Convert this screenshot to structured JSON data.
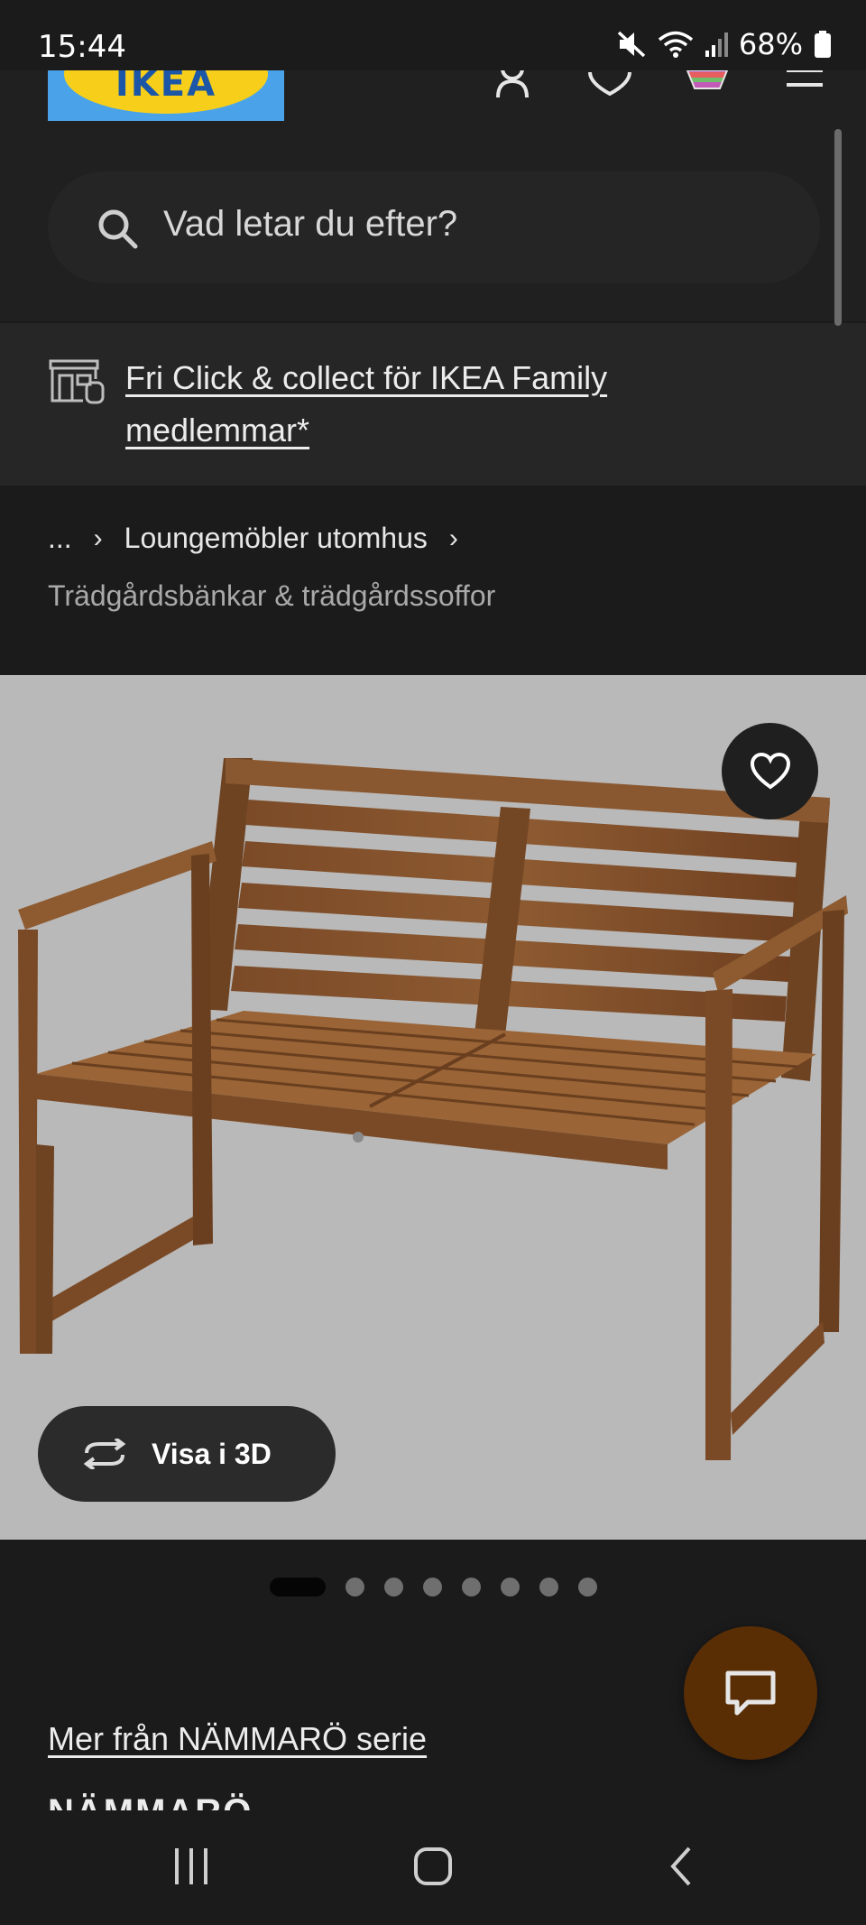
{
  "status_bar": {
    "time": "15:44",
    "battery": "68%",
    "icons": [
      "mute-icon",
      "wifi-icon",
      "signal-icon",
      "battery-icon"
    ]
  },
  "header": {
    "logo_text": "IKEA",
    "icons": [
      "account-icon",
      "heart-icon",
      "shopping-bag-icon",
      "menu-icon"
    ]
  },
  "search": {
    "placeholder": "Vad letar du efter?"
  },
  "banner": {
    "text": "Fri Click & collect för IKEA Family medlemmar*"
  },
  "breadcrumb": {
    "ellipsis": "...",
    "parent": "Loungemöbler utomhus",
    "current": "Trädgårdsbänkar & trädgårdssoffor"
  },
  "product": {
    "view_3d_label": "Visa i 3D",
    "image_count": 8,
    "active_image": 1,
    "series_link": "Mer från NÄMMARÖ serie",
    "name": "NÄMMARÖ"
  },
  "colors": {
    "background": "#1b1b1c",
    "image_bg": "#b9b9b9",
    "chat_button": "#5a2e05",
    "logo_blue": "#4aa3e8",
    "logo_yellow": "#f7cf1a"
  }
}
